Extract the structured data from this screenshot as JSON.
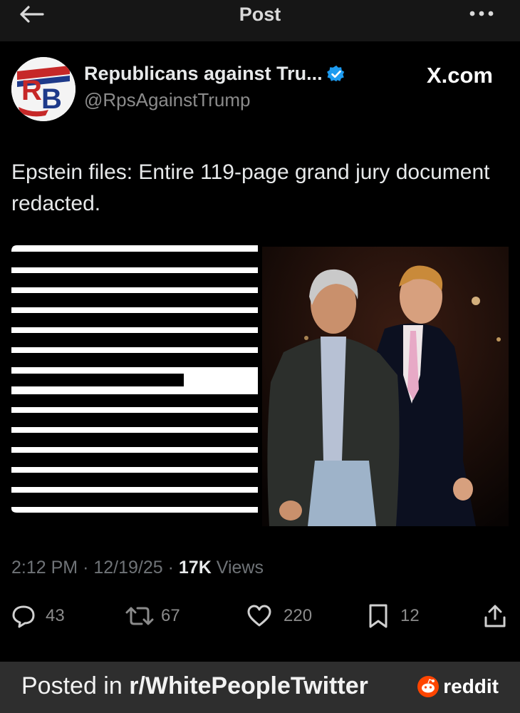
{
  "header": {
    "title": "Post",
    "back_icon": "arrow-left-icon",
    "more_icon": "ellipsis-icon"
  },
  "post": {
    "author_name": "Republicans against Tru...",
    "author_handle": "@RpsAgainstTrump",
    "avatar_text": "RB",
    "verified": true,
    "source_label": "X.com",
    "text": "Epstein files: Entire 119-page grand jury document redacted.",
    "time": "2:12 PM",
    "date": "12/19/25",
    "views_count": "17K",
    "views_label": "Views",
    "separator": "·"
  },
  "actions": {
    "replies": "43",
    "reposts": "67",
    "likes": "220",
    "bookmarks": "12"
  },
  "footer": {
    "prefix": "Posted in ",
    "subreddit": "r/WhitePeopleTwitter",
    "brand": "reddit"
  },
  "colors": {
    "background": "#000000",
    "header_bar": "#161616",
    "footer_bar": "#2e2e2e",
    "verified": "#1d9bf0",
    "muted": "#8b8b8b",
    "reddit_orange": "#ff4500"
  }
}
